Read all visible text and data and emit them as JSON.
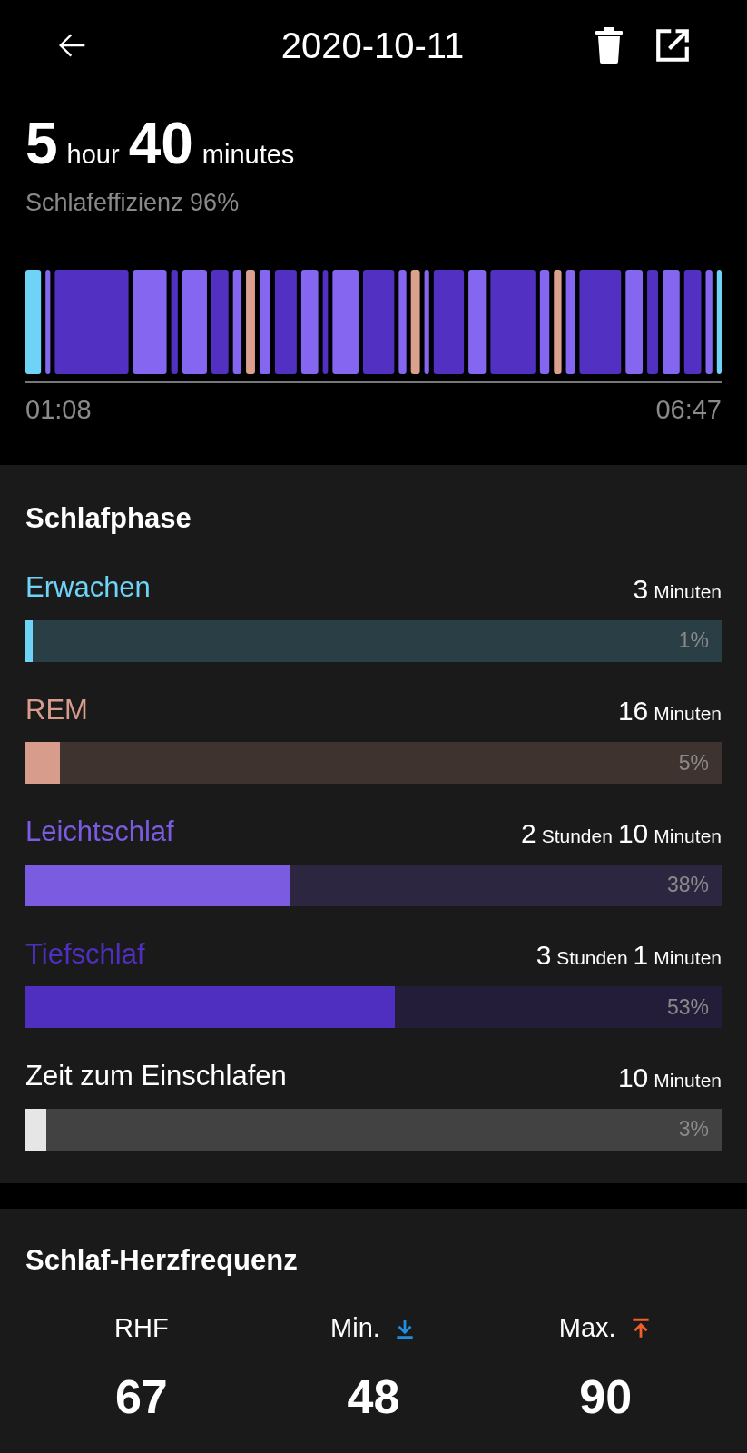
{
  "header": {
    "title": "2020-10-11"
  },
  "summary": {
    "hours": "5",
    "hours_unit": "hour",
    "minutes": "40",
    "minutes_unit": "minutes",
    "efficiency": "Schlafeffizienz 96%"
  },
  "timeline": {
    "start": "01:08",
    "end": "06:47"
  },
  "phases": {
    "title": "Schlafphase",
    "items": [
      {
        "name": "Erwachen",
        "color": "#6fd3f7",
        "duration": [
          {
            "value": "3",
            "unit": "Minuten"
          }
        ],
        "level": 0.01,
        "percent": "1%"
      },
      {
        "name": "REM",
        "color": "#d79c8c",
        "duration": [
          {
            "value": "16",
            "unit": "Minuten"
          }
        ],
        "level": 0.05,
        "percent": "5%"
      },
      {
        "name": "Leichtschlaf",
        "color": "#7b5ce0",
        "duration": [
          {
            "value": "2",
            "unit": "Stunden"
          },
          {
            "value": "10",
            "unit": "Minuten"
          }
        ],
        "level": 0.38,
        "percent": "38%"
      },
      {
        "name": "Tiefschlaf",
        "color": "#4f2fc0",
        "duration": [
          {
            "value": "3",
            "unit": "Stunden"
          },
          {
            "value": "1",
            "unit": "Minuten"
          }
        ],
        "level": 0.53,
        "percent": "53%"
      },
      {
        "name": "Zeit zum Einschlafen",
        "color": "#e6e6e6",
        "duration": [
          {
            "value": "10",
            "unit": "Minuten"
          }
        ],
        "level": 0.03,
        "percent": "3%"
      }
    ]
  },
  "heart_rate": {
    "title": "Schlaf-Herzfrequenz",
    "stats": [
      {
        "kind": "rest",
        "label": "RHF",
        "value": "67"
      },
      {
        "kind": "min",
        "label": "Min.",
        "value": "48"
      },
      {
        "kind": "max",
        "label": "Max.",
        "value": "90"
      }
    ]
  }
}
